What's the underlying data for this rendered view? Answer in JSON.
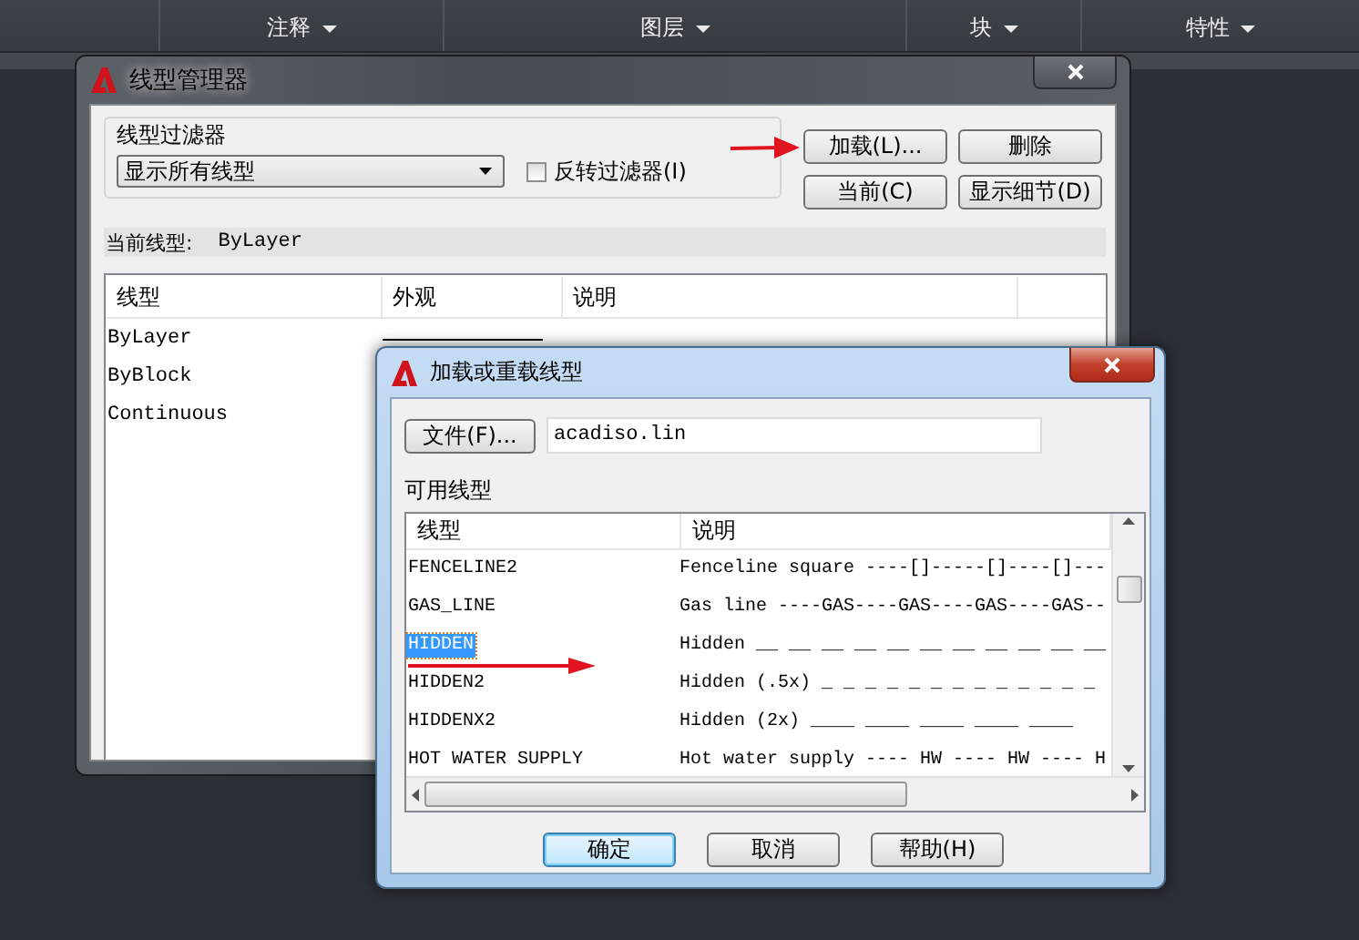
{
  "ribbon": {
    "panels": [
      {
        "label": "注释",
        "has_menu": true
      },
      {
        "label": "图层",
        "has_menu": true
      },
      {
        "label": "块",
        "has_menu": true
      },
      {
        "label": "特性",
        "has_menu": true
      }
    ]
  },
  "linetype_manager": {
    "title": "线型管理器",
    "filter_label": "线型过滤器",
    "filter_value": "显示所有线型",
    "invert_filter": {
      "label": "反转过滤器(I)",
      "checked": false
    },
    "buttons": [
      {
        "label": "加载(L)..."
      },
      {
        "label": "删除"
      },
      {
        "label": "当前(C)"
      },
      {
        "label": "显示细节(D)"
      }
    ],
    "current_linetype_label": "当前线型:",
    "current_linetype": "ByLayer",
    "columns": [
      "线型",
      "外观",
      "说明"
    ],
    "rows": [
      {
        "name": "ByLayer",
        "has_preview": true
      },
      {
        "name": "ByBlock"
      },
      {
        "name": "Continuous"
      }
    ]
  },
  "load_dialog": {
    "title": "加载或重载线型",
    "file_button": "文件(F)...",
    "file_name": "acadiso.lin",
    "available_label": "可用线型",
    "columns": [
      "线型",
      "说明"
    ],
    "rows": [
      {
        "name": "FENCELINE2",
        "description": "Fenceline square ----[]-----[]----[]---",
        "selected": false
      },
      {
        "name": "GAS_LINE",
        "description": "Gas line ----GAS----GAS----GAS----GAS--",
        "selected": false
      },
      {
        "name": "HIDDEN",
        "description": "Hidden __ __ __ __ __ __ __ __ __ __ __",
        "selected": true
      },
      {
        "name": "HIDDEN2",
        "description": "Hidden (.5x) _ _ _ _ _ _ _ _ _ _ _ _ _",
        "selected": false
      },
      {
        "name": "HIDDENX2",
        "description": "Hidden (2x) ____ ____ ____ ____ ____",
        "selected": false
      },
      {
        "name": "HOT WATER SUPPLY",
        "description": "Hot water supply ---- HW ---- HW ---- H",
        "selected": false
      }
    ],
    "buttons": [
      {
        "label": "确定",
        "default": true
      },
      {
        "label": "取消",
        "default": false
      },
      {
        "label": "帮助(H)",
        "default": false
      }
    ]
  }
}
